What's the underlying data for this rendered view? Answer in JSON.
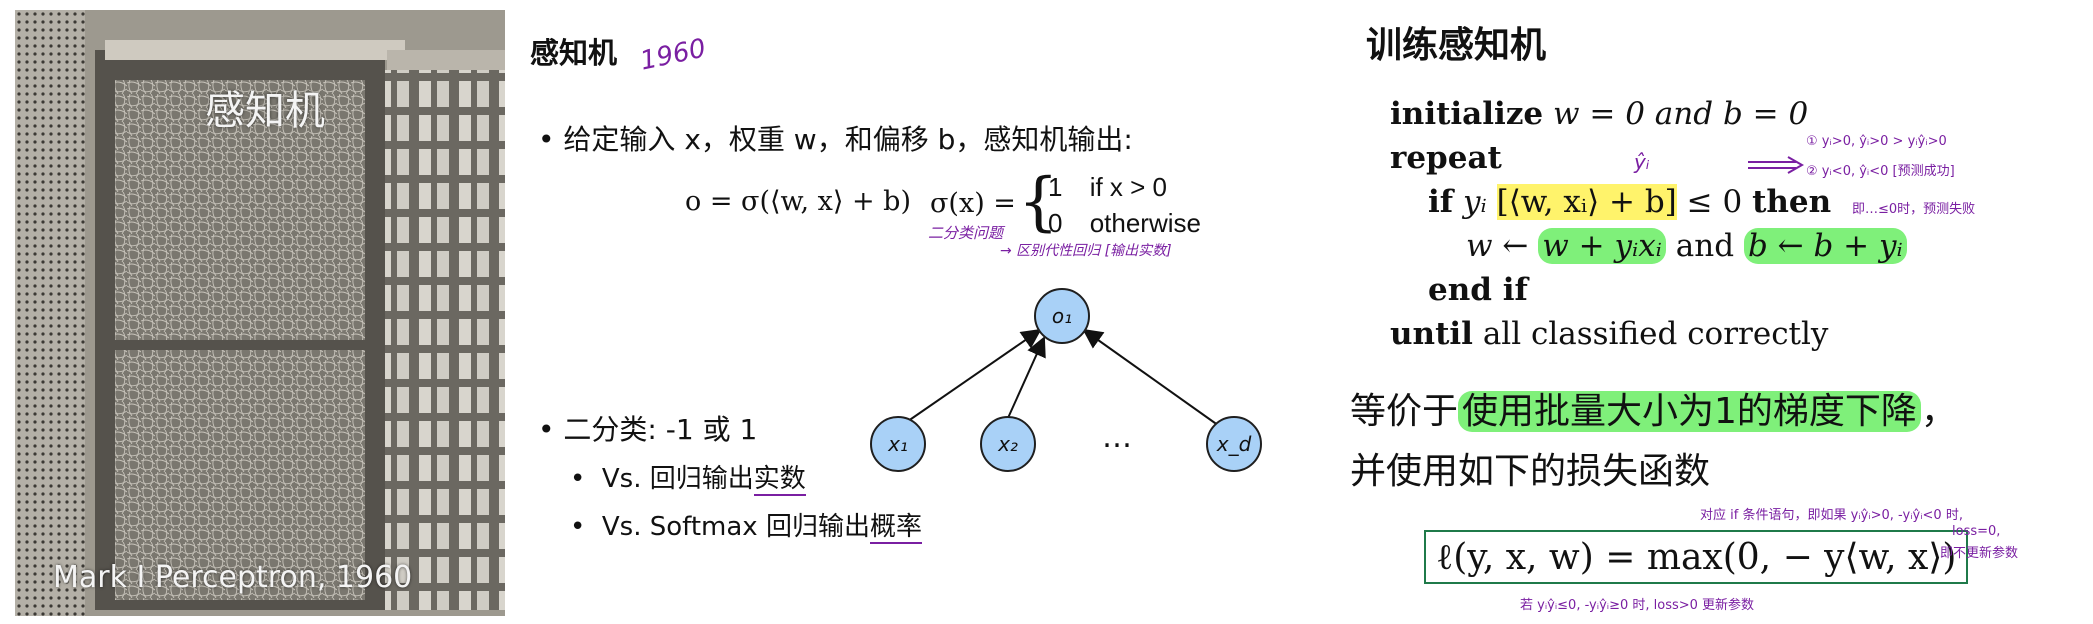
{
  "photo": {
    "panel_label": "感知机",
    "caption": "Mark I Perceptron, 1960"
  },
  "middle": {
    "title": "感知机",
    "title_note": "1960",
    "bullet1": "给定输入 x，权重 w，和偏移 b，感知机输出:",
    "formula_o": "o = σ(⟨w, x⟩ + b)",
    "sigma_lhs": "σ(x) =",
    "sigma_case1_val": "1",
    "sigma_case1_cond": "if x > 0",
    "sigma_case0_val": "0",
    "sigma_case0_cond": "otherwise",
    "note_binary": "二分类问题",
    "note_regression": "→ 区别代性回归 [输出实数]",
    "bullet2": "二分类: -1 或 1",
    "sub1_prefix": "Vs. 回归输出",
    "sub1_underlined": "实数",
    "sub2_prefix": "Vs. Softmax 回归输出",
    "sub2_underlined": "概率",
    "nodes": {
      "o1": "o₁",
      "x1": "x₁",
      "x2": "x₂",
      "ellipsis": "…",
      "xd": "x_d"
    }
  },
  "right": {
    "title": "训练感知机",
    "line1_kw": "initialize",
    "line1_rest": "w = 0 and b = 0",
    "line2_kw": "repeat",
    "line3_kw": "if",
    "line3_yi": "yᵢ",
    "line3_hl": "[⟨w, xᵢ⟩ + b]",
    "line3_rest": "≤ 0",
    "line3_then": "then",
    "line4_lhs": "w ←",
    "line4_hl1": "w + yᵢxᵢ",
    "line4_and": "and",
    "line4_hl2": "b ← b + yᵢ",
    "line5_kw": "end if",
    "line6_kw": "until",
    "line6_rest": "all classified correctly",
    "equiv_prefix": "等价于",
    "equiv_hl": "使用批量大小为1的梯度下降",
    "equiv_suffix": "，",
    "equiv_line2": "并使用如下的损失函数",
    "loss": "ℓ(y, x, w) = max(0, − y⟨w, x⟩)",
    "notes": {
      "yhat": "ŷᵢ",
      "cases1": "① yᵢ>0, ŷᵢ>0  > yᵢŷᵢ>0",
      "cases2": "② yᵢ<0, ŷᵢ<0  [预测成功]",
      "fail": "即…≤0时，预测失败",
      "loss_note1": "对应 if 条件语句，即如果 yᵢŷᵢ>0, -yᵢŷᵢ<0 时,",
      "loss_note2": "loss=0,",
      "loss_note3": "即不更新参数",
      "loss_note4": "若 yᵢŷᵢ≤0, -yᵢŷᵢ≥0 时, loss>0 更新参数"
    }
  }
}
